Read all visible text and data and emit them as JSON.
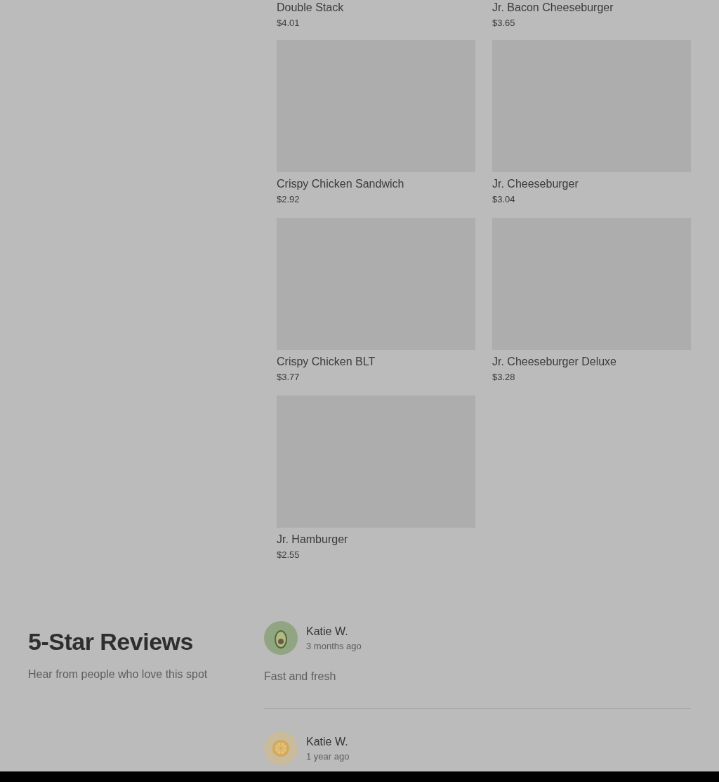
{
  "menu_items": [
    {
      "name": "Double Stack",
      "price": "$4.01"
    },
    {
      "name": "Jr. Bacon Cheeseburger",
      "price": "$3.65"
    },
    {
      "name": "Crispy Chicken Sandwich",
      "price": "$2.92"
    },
    {
      "name": "Jr. Cheeseburger",
      "price": "$3.04"
    },
    {
      "name": "Crispy Chicken BLT",
      "price": "$3.77"
    },
    {
      "name": "Jr. Cheeseburger Deluxe",
      "price": "$3.28"
    },
    {
      "name": "Jr. Hamburger",
      "price": "$2.55"
    }
  ],
  "reviews_section": {
    "title": "5-Star Reviews",
    "subtitle": "Hear from people who love this spot",
    "reviews": [
      {
        "author": "Katie W.",
        "time": "3 months ago",
        "text": "Fast and fresh",
        "avatar": {
          "kind": "avocado"
        }
      },
      {
        "author": "Katie W.",
        "time": "1 year ago",
        "avatar": {
          "kind": "citrus"
        }
      }
    ]
  }
}
